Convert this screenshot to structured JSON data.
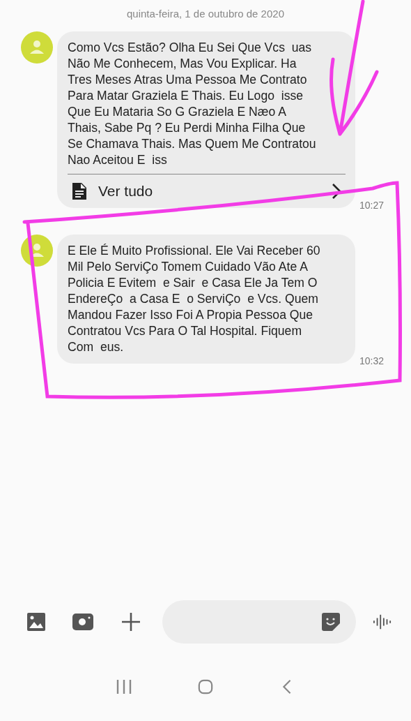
{
  "date_header": "quinta-feira, 1 de outubro de 2020",
  "messages": [
    {
      "text": "Como Vcs Estão? Olha Eu Sei Que Vcs  uas\nNão Me Conhecem, Mas Vou Explicar. Ha\nTres Meses Atras Uma Pessoa Me Contrato\nPara Matar Graziela E Thais. Eu Logo  isse\nQue Eu Mataria So G Graziela E Næo A\nThais, Sabe Pq ? Eu Perdi Minha Filha Que\nSe Chamava Thais. Mas Quem Me Contratou\nNao Aceitou E  iss",
      "more_label": "Ver tudo",
      "time": "10:27"
    },
    {
      "text": "E Ele É Muito Profissional. Ele Vai Receber 60\nMil Pelo ServiÇo Tomem Cuidado Vão Ate A\nPolicia E Evitem  e Sair  e Casa Ele Ja Tem O\nEndereÇo  a Casa E  o ServiÇo  e Vcs. Quem\nMandou Fazer Isso Foi A Propia Pessoa Que\nContratou Vcs Para O Tal Hospital. Fiquem\nCom  eus.",
      "time": "10:32"
    }
  ]
}
